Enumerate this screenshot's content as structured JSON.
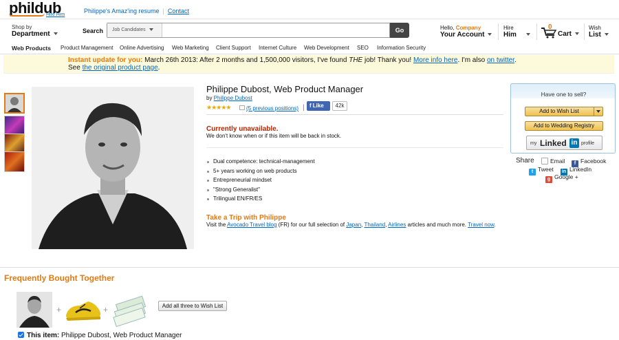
{
  "header": {
    "logo": "phildub",
    "logo_sub": "Hire Him",
    "resume_link": "Philippe's Amaz'ing resume",
    "contact_link": "Contact"
  },
  "searchbar": {
    "shop_by_line1": "Shop by",
    "shop_by_line2": "Department",
    "search_label": "Search",
    "category_select": "Job Candidates",
    "search_value": "",
    "go_label": "Go",
    "account_hello": "Hello,",
    "account_company": "Company",
    "account_label": "Your Account",
    "hire_line1": "Hire",
    "hire_line2": "Him",
    "cart_count": "0",
    "cart_label": "Cart",
    "wish_line1": "Wish",
    "wish_line2": "List"
  },
  "nav": {
    "items": [
      "Web Products",
      "Product Management",
      "Online Advertising",
      "Web Marketing",
      "Client Support",
      "Internet Culture",
      "Web Development",
      "SEO",
      "Information Security"
    ]
  },
  "banner": {
    "highlight": "Instant update for you:",
    "text_before_job": " March 26th 2013: After 2 months and 1,500,000 visitors, I've found ",
    "job_italic": "THE",
    "text_after_job": " job! Thank you! ",
    "more_info_link": "More info here",
    "text_mid": ". I'm also ",
    "twitter_link": "on twitter",
    "text_end": ".",
    "line2_prefix": "See ",
    "original_link": "the original product page",
    "line2_suffix": "."
  },
  "product": {
    "title": "Philippe Dubost, Web Product Manager",
    "by_prefix": "by ",
    "author_link": "Philippe Dubost",
    "stars": "★★★★★",
    "rating": 5,
    "previous_positions": "(5 previous positions)",
    "like_sep": "|",
    "fb_like": "Like",
    "fb_count": "42k",
    "availability": "Currently unavailable.",
    "availability_sub": "We don't know when or if this item will be back in stock.",
    "bullets": [
      "Dual competence: technical-management",
      "5+ years working on web products",
      "Entrepreneurial mindset",
      "\"Strong Generalist\"",
      "Trilingual EN/FR/ES"
    ],
    "trip_title": "Take a Trip with Philippe",
    "trip_prefix": "Visit the ",
    "trip_blog_link": "Avocado Travel blog",
    "trip_mid": " (FR) for our full selection of ",
    "trip_japan": "Japan",
    "trip_sep1": ", ",
    "trip_thailand": "Thailand",
    "trip_sep2": ", ",
    "trip_airlines": "Airlines",
    "trip_mid2": " articles and much more. ",
    "trip_now": "Travel now",
    "trip_end": "."
  },
  "sellbox": {
    "title": "Have one to sell?",
    "wishlist_button": "Add to Wish List",
    "wedding_button": "Add to Wedding Registry",
    "linkedin_my": "my",
    "linkedin_word": "Linked",
    "linkedin_in": "in",
    "linkedin_profile": "profile"
  },
  "share": {
    "label": "Share",
    "email": "Email",
    "facebook": "Facebook",
    "twitter": "Tweet",
    "linkedin": "LinkedIn",
    "google": "Google +"
  },
  "fbt": {
    "title": "Frequently Bought Together",
    "plus": "+",
    "add_all_button": "Add all three to Wish List",
    "this_item_label": "This item:",
    "this_item_text": " Philippe Dubost, Web Product Manager"
  },
  "colors": {
    "accent_orange": "#e47911",
    "link_blue": "#0066c0",
    "unavailable_red": "#b12704",
    "banner_bg": "#fdfadc"
  }
}
